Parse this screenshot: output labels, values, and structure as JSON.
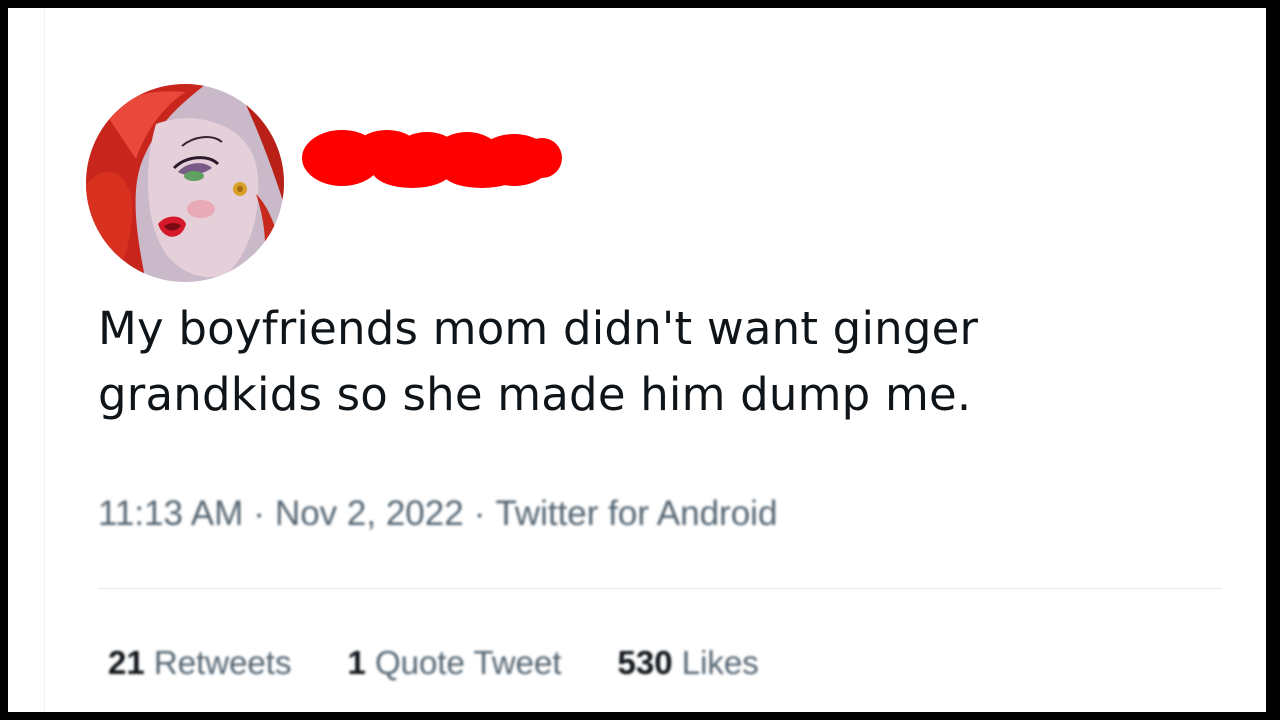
{
  "tweet": {
    "text_line1": "My boyfriends mom didn't want ginger",
    "text_line2": "grandkids so she made him dump me.",
    "time": "11:13 AM",
    "separator": "·",
    "date": "Nov 2, 2022",
    "source": "Twitter for Android"
  },
  "stats": {
    "retweets_count": "21",
    "retweets_label": "Retweets",
    "quotes_count": "1",
    "quotes_label": "Quote Tweet",
    "likes_count": "530",
    "likes_label": "Likes"
  },
  "colors": {
    "text": "#0f1419",
    "muted": "#536471",
    "redaction": "#ff0000",
    "avatar_hair": "#d42a1f"
  },
  "icons": {
    "avatar": "cartoon-redhead-avatar",
    "redaction": "red-scribble-redaction"
  }
}
